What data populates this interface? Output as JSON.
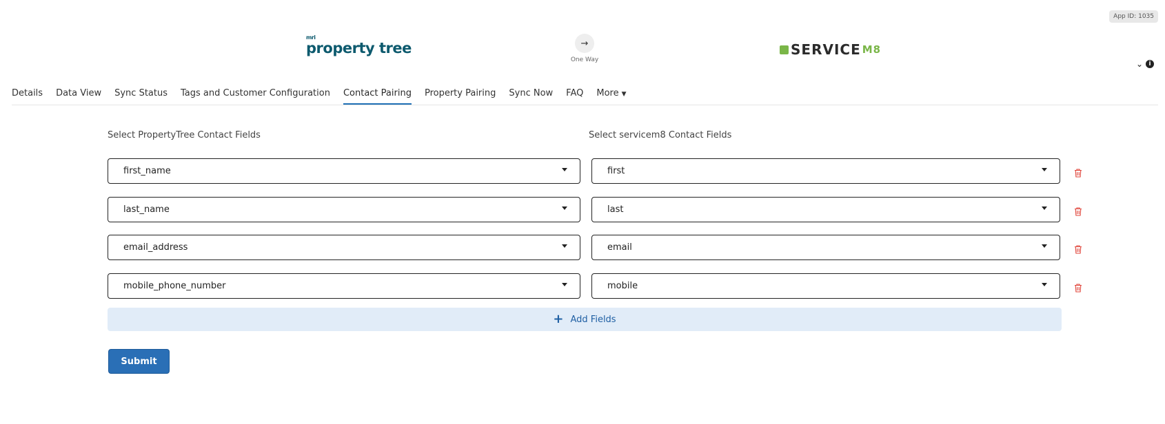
{
  "app_id": "App ID: 1035",
  "header": {
    "source_logo_prefix": "mri",
    "source_logo": "property tree",
    "sync_icon": "arrow-right-icon",
    "sync_label": "One Way",
    "target_logo": "SERVICE",
    "target_logo_suffix": "M8"
  },
  "tabs": [
    {
      "label": "Details"
    },
    {
      "label": "Data View"
    },
    {
      "label": "Sync Status"
    },
    {
      "label": "Tags and Customer Configuration"
    },
    {
      "label": "Contact Pairing"
    },
    {
      "label": "Property Pairing"
    },
    {
      "label": "Sync Now"
    },
    {
      "label": "FAQ"
    },
    {
      "label": "More"
    }
  ],
  "active_tab": "Contact Pairing",
  "form": {
    "left_label": "Select PropertyTree Contact Fields",
    "right_label": "Select servicem8 Contact Fields",
    "rows": [
      {
        "left": "first_name",
        "right": "first"
      },
      {
        "left": "last_name",
        "right": "last"
      },
      {
        "left": "email_address",
        "right": "email"
      },
      {
        "left": "mobile_phone_number",
        "right": "mobile"
      }
    ],
    "add_label": "Add Fields",
    "submit_label": "Submit"
  },
  "colors": {
    "accent": "#2a6fb6",
    "delete": "#e0443a",
    "add_bg": "#e1ecf8",
    "pt_brand": "#0d5a6e",
    "sm8_brand": "#7ab648"
  }
}
